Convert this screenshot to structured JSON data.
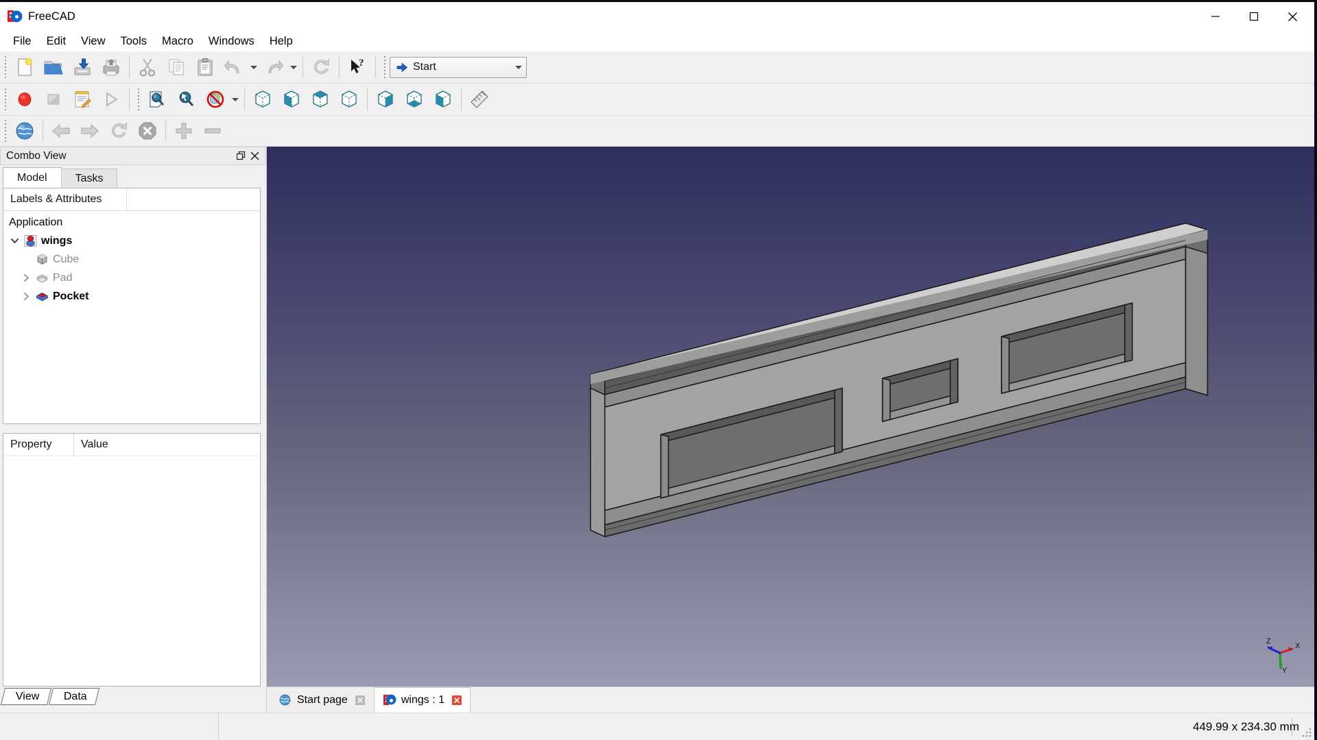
{
  "window": {
    "title": "FreeCAD",
    "logo_icon": "freecad-logo-icon",
    "minimize_label": "Minimize",
    "maximize_label": "Maximize",
    "close_label": "Close"
  },
  "menubar": {
    "items": [
      {
        "label": "File"
      },
      {
        "label": "Edit"
      },
      {
        "label": "View"
      },
      {
        "label": "Tools"
      },
      {
        "label": "Macro"
      },
      {
        "label": "Windows"
      },
      {
        "label": "Help"
      }
    ]
  },
  "toolbars": {
    "file": [
      {
        "name": "new-document-button",
        "icon": "new-document-icon",
        "label": "New"
      },
      {
        "name": "open-document-button",
        "icon": "open-folder-icon",
        "label": "Open"
      },
      {
        "name": "save-document-button",
        "icon": "save-icon",
        "label": "Save"
      },
      {
        "name": "print-document-button",
        "icon": "print-icon",
        "label": "Print"
      }
    ],
    "edit": [
      {
        "name": "cut-button",
        "icon": "scissors-icon",
        "label": "Cut"
      },
      {
        "name": "copy-button",
        "icon": "copy-icon",
        "label": "Copy"
      },
      {
        "name": "paste-button",
        "icon": "clipboard-paste-icon",
        "label": "Paste"
      },
      {
        "name": "undo-button",
        "icon": "undo-arrow-icon",
        "label": "Undo"
      },
      {
        "name": "redo-button",
        "icon": "redo-arrow-icon",
        "label": "Redo"
      },
      {
        "name": "refresh-button",
        "icon": "refresh-icon",
        "label": "Refresh"
      },
      {
        "name": "whats-this-button",
        "icon": "cursor-question-icon",
        "label": "What's This?"
      }
    ],
    "workbench": {
      "selected": "Start",
      "icon": "blue-arrow-icon",
      "dropdown_icon": "chevron-down-icon"
    },
    "macro": [
      {
        "name": "macro-record-button",
        "icon": "record-circle-icon",
        "label": "Macro recording"
      },
      {
        "name": "macro-stop-button",
        "icon": "stop-square-icon",
        "label": "Stop macro recording"
      },
      {
        "name": "macros-button",
        "icon": "notepad-pencil-icon",
        "label": "Macros"
      },
      {
        "name": "execute-macro-button",
        "icon": "play-triangle-icon",
        "label": "Execute macro"
      }
    ],
    "view": [
      {
        "name": "fit-all-button",
        "icon": "magnifier-page-icon",
        "label": "Fit all"
      },
      {
        "name": "fit-selection-button",
        "icon": "magnifier-arrow-icon",
        "label": "Fit selection"
      },
      {
        "name": "draw-style-button",
        "icon": "draw-style-icon",
        "label": "Draw style"
      },
      {
        "name": "axonometric-view-button",
        "icon": "cube-iso-icon",
        "label": "Axonometric"
      },
      {
        "name": "front-view-button",
        "icon": "cube-front-icon",
        "label": "Front"
      },
      {
        "name": "top-view-button",
        "icon": "cube-top-icon",
        "label": "Top"
      },
      {
        "name": "right-view-button",
        "icon": "cube-right-icon",
        "label": "Right"
      },
      {
        "name": "rear-view-button",
        "icon": "cube-rear-icon",
        "label": "Rear"
      },
      {
        "name": "bottom-view-button",
        "icon": "cube-bottom-icon",
        "label": "Bottom"
      },
      {
        "name": "left-view-button",
        "icon": "cube-left-icon",
        "label": "Left"
      },
      {
        "name": "measure-button",
        "icon": "ruler-icon",
        "label": "Measure"
      }
    ],
    "navigation": [
      {
        "name": "web-home-button",
        "icon": "globe-icon",
        "label": "Home"
      },
      {
        "name": "browser-back-button",
        "icon": "arrow-left-icon",
        "label": "Previous page"
      },
      {
        "name": "browser-forward-button",
        "icon": "arrow-right-icon",
        "label": "Next page"
      },
      {
        "name": "browser-refresh-button",
        "icon": "refresh-icon",
        "label": "Refresh page"
      },
      {
        "name": "browser-stop-button",
        "icon": "stop-x-icon",
        "label": "Stop loading"
      },
      {
        "name": "zoom-in-button",
        "icon": "plus-icon",
        "label": "Zoom in"
      },
      {
        "name": "zoom-out-button",
        "icon": "minus-icon",
        "label": "Zoom out"
      }
    ]
  },
  "combo_view": {
    "title": "Combo View",
    "float_icon": "restore-icon",
    "close_icon": "close-icon",
    "tabs": [
      {
        "label": "Model",
        "active": true
      },
      {
        "label": "Tasks",
        "active": false
      }
    ],
    "tree": {
      "columns": [
        "Labels & Attributes",
        ""
      ],
      "root": {
        "label": "Application"
      },
      "nodes": [
        {
          "label": "wings",
          "icon": "document-icon",
          "style": "root",
          "expanded": true,
          "has_twist": true
        },
        {
          "label": "Cube",
          "icon": "cube-solid-icon",
          "style": "dim",
          "has_twist": false
        },
        {
          "label": "Pad",
          "icon": "pad-icon",
          "style": "dim",
          "has_twist": true
        },
        {
          "label": "Pocket",
          "icon": "pocket-icon",
          "style": "bold",
          "has_twist": true
        }
      ]
    },
    "property_editor": {
      "columns": [
        "Property",
        "Value"
      ],
      "rows": []
    },
    "bottom_tabs": [
      {
        "label": "View"
      },
      {
        "label": "Data"
      }
    ]
  },
  "viewport": {
    "axis_labels": {
      "x": "X",
      "y": "Y",
      "z": "Z"
    },
    "axis_colors": {
      "x": "#cc2020",
      "y": "#18a018",
      "z": "#2020cc"
    },
    "background_top": "#2e2e5e",
    "background_bottom": "#9a9ab0",
    "model_name": "wings-spar-model",
    "model_face_color": "#a6a6a6",
    "model_edge_color": "#1a1a1a"
  },
  "document_tabs": [
    {
      "label": "Start page",
      "icon": "globe-icon",
      "active": false,
      "close_icon": "close-grey-icon"
    },
    {
      "label": "wings : 1",
      "icon": "freecad-logo-icon",
      "active": true,
      "close_icon": "close-red-icon"
    }
  ],
  "statusbar": {
    "dimensions": "449.99 x 234.30 mm"
  }
}
